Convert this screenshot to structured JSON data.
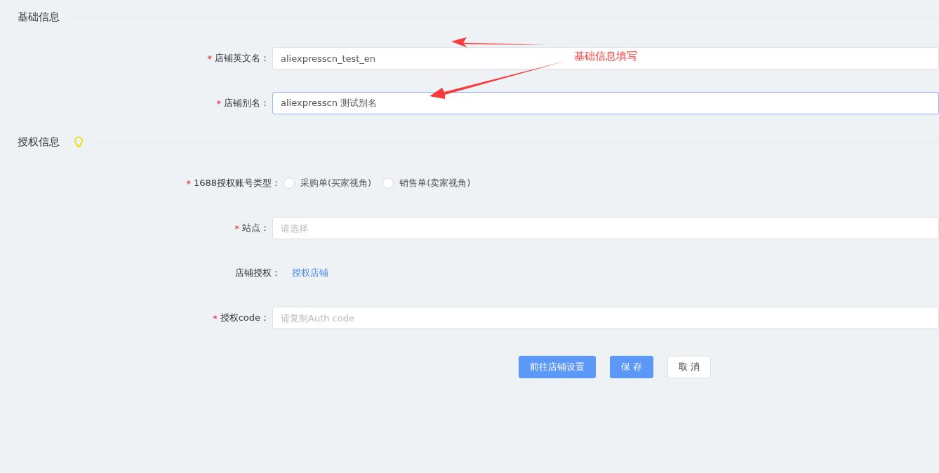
{
  "sections": [
    {
      "title": "基础信息",
      "tip": false,
      "fields": [
        {
          "kind": "text",
          "label": "店铺英文名：",
          "required_mark": "*",
          "value": "aliexpresscn_test_en",
          "focused": false
        },
        {
          "kind": "text",
          "label": "店铺别名：",
          "required_mark": "*",
          "value": "aliexpresscn 测试别名",
          "focused": true
        }
      ]
    },
    {
      "title": "授权信息",
      "tip": true,
      "fields": [
        {
          "kind": "radio",
          "label": "1688授权账号类型：",
          "required_mark": "*",
          "options": [
            {
              "label": "采购单(买家视角)",
              "selected": false
            },
            {
              "label": "销售单(卖家视角)",
              "selected": false
            }
          ]
        },
        {
          "kind": "select",
          "label": "站点：",
          "required_mark": "*",
          "placeholder": "请选择",
          "focused": false
        },
        {
          "kind": "link",
          "label": "店铺授权：",
          "link": "授权店铺"
        },
        {
          "kind": "text",
          "label": "授权code：",
          "required_mark": "*",
          "placeholder": "请复制Auth code",
          "focused": false
        }
      ]
    }
  ],
  "buttons": [
    {
      "label": "前往店铺设置",
      "kind": "primary"
    },
    {
      "label": "保 存",
      "kind": "primary"
    },
    {
      "label": "取 消",
      "kind": "default"
    }
  ],
  "annotation": {
    "text": "基础信息填写"
  }
}
